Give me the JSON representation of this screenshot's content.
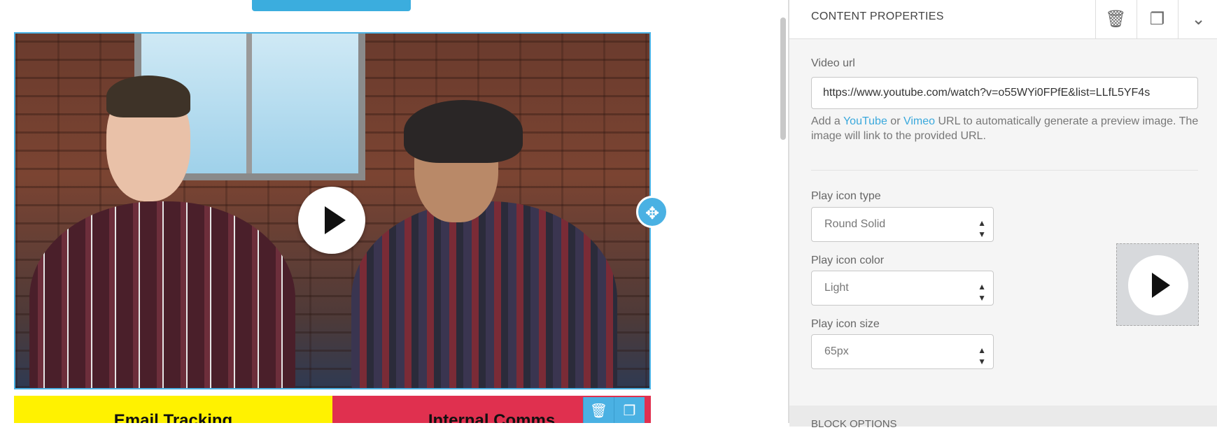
{
  "panel": {
    "title": "CONTENT PROPERTIES",
    "video_url_label": "Video url",
    "video_url_value": "https://www.youtube.com/watch?v=o55WYi0FPfE&list=LLfL5YF4s",
    "hint_prefix": "Add a ",
    "hint_youtube": "YouTube",
    "hint_or": " or ",
    "hint_vimeo": "Vimeo",
    "hint_suffix": " URL to automatically generate a preview image. The image will link to the provided URL.",
    "play_icon_type_label": "Play icon type",
    "play_icon_type_value": "Round Solid",
    "play_icon_color_label": "Play icon color",
    "play_icon_color_value": "Light",
    "play_icon_size_label": "Play icon size",
    "play_icon_size_value": "65px",
    "block_options_label": "BLOCK OPTIONS"
  },
  "canvas": {
    "tile_1": "Email Tracking",
    "tile_2": "Internal Comms"
  },
  "icons": {
    "delete": "trash-icon",
    "duplicate": "duplicate-icon",
    "collapse": "chevron-down-icon",
    "move": "move-icon",
    "play": "play-icon"
  },
  "colors": {
    "accent": "#4ab1e3",
    "tile_yellow": "#fff200",
    "tile_red": "#e0304f"
  }
}
